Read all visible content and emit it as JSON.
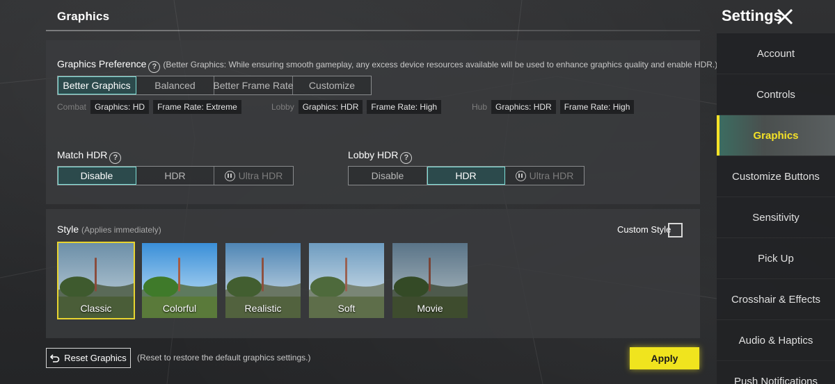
{
  "header": {
    "page_title": "Graphics",
    "settings_title": "Settings"
  },
  "graphics_preference": {
    "label": "Graphics Preference",
    "note": "(Better Graphics: While ensuring smooth gameplay, any excess device resources available will be used to enhance graphics quality and enable HDR.)",
    "options": [
      "Better Graphics",
      "Balanced",
      "Better Frame Rate",
      "Customize"
    ],
    "selected": "Better Graphics"
  },
  "modes": {
    "combat": {
      "label": "Combat",
      "graphics": "Graphics: HD",
      "frame_rate": "Frame Rate: Extreme"
    },
    "lobby": {
      "label": "Lobby",
      "graphics": "Graphics: HDR",
      "frame_rate": "Frame Rate: High"
    },
    "hub": {
      "label": "Hub",
      "graphics": "Graphics: HDR",
      "frame_rate": "Frame Rate: High"
    }
  },
  "match_hdr": {
    "label": "Match HDR",
    "options": [
      "Disable",
      "HDR",
      "Ultra HDR"
    ],
    "selected": "Disable"
  },
  "lobby_hdr": {
    "label": "Lobby HDR",
    "options": [
      "Disable",
      "HDR",
      "Ultra HDR"
    ],
    "selected": "HDR"
  },
  "style": {
    "label": "Style",
    "note": "(Applies immediately)",
    "custom_label": "Custom Style",
    "options": [
      "Classic",
      "Colorful",
      "Realistic",
      "Soft",
      "Movie"
    ],
    "selected": "Classic"
  },
  "footer": {
    "reset_label": "Reset Graphics",
    "reset_note": "(Reset to restore the default graphics settings.)",
    "apply_label": "Apply"
  },
  "sidebar": {
    "items": [
      "Account",
      "Controls",
      "Graphics",
      "Customize Buttons",
      "Sensitivity",
      "Pick Up",
      "Crosshair & Effects",
      "Audio & Haptics",
      "Push Notifications"
    ],
    "active": "Graphics"
  },
  "colors": {
    "accent_yellow": "#f0e41e",
    "accent_teal": "#7fe0d8"
  }
}
